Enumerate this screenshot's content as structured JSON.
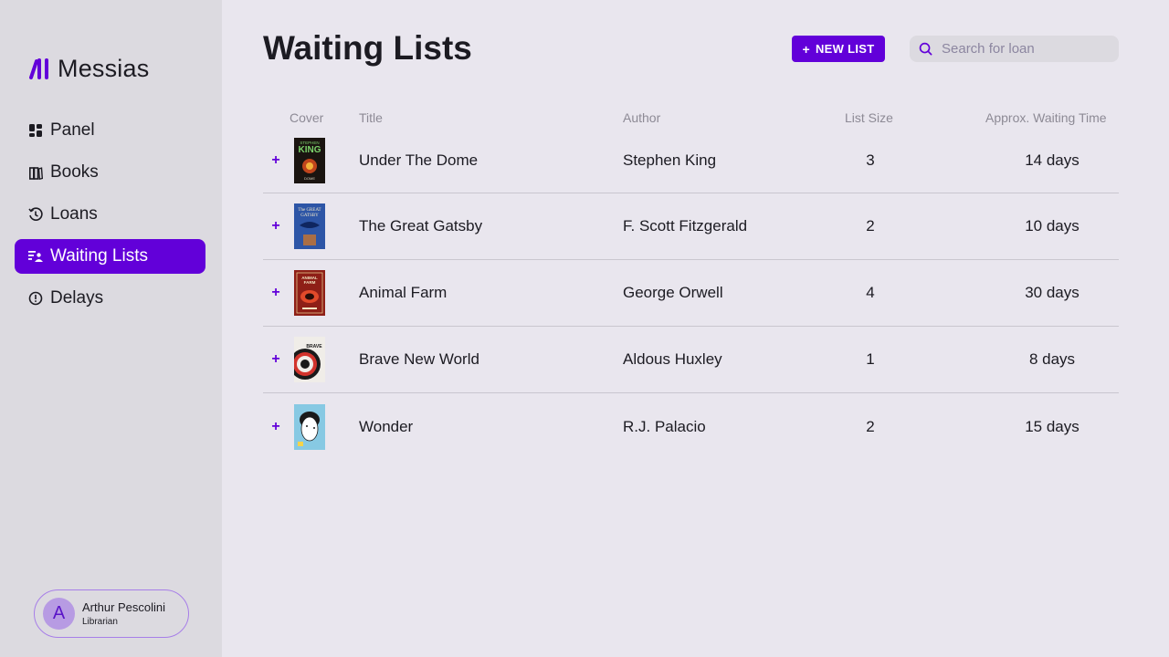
{
  "brand": {
    "name": "Messias",
    "accent": "#6200d9"
  },
  "sidebar": {
    "items": [
      {
        "label": "Panel",
        "icon": "panel-icon",
        "active": false
      },
      {
        "label": "Books",
        "icon": "books-icon",
        "active": false
      },
      {
        "label": "Loans",
        "icon": "loans-icon",
        "active": false
      },
      {
        "label": "Waiting Lists",
        "icon": "waiting-list-icon",
        "active": true
      },
      {
        "label": "Delays",
        "icon": "delay-icon",
        "active": false
      }
    ]
  },
  "user": {
    "initial": "A",
    "name": "Arthur Pescolini",
    "role": "Librarian"
  },
  "header": {
    "title": "Waiting Lists",
    "new_list_label": "NEW LIST",
    "search_placeholder": "Search for loan"
  },
  "table": {
    "columns": {
      "cover": "Cover",
      "title": "Title",
      "author": "Author",
      "size": "List Size",
      "wait": "Approx. Waiting Time"
    },
    "rows": [
      {
        "title": "Under The Dome",
        "author": "Stephen King",
        "size": "3",
        "wait": "14 days",
        "cover_icon": "under-the-dome-cover"
      },
      {
        "title": "The Great Gatsby",
        "author": "F. Scott Fitzgerald",
        "size": "2",
        "wait": "10 days",
        "cover_icon": "great-gatsby-cover"
      },
      {
        "title": "Animal Farm",
        "author": "George Orwell",
        "size": "4",
        "wait": "30 days",
        "cover_icon": "animal-farm-cover"
      },
      {
        "title": "Brave New World",
        "author": "Aldous Huxley",
        "size": "1",
        "wait": "8 days",
        "cover_icon": "brave-new-world-cover"
      },
      {
        "title": "Wonder",
        "author": "R.J. Palacio",
        "size": "2",
        "wait": "15 days",
        "cover_icon": "wonder-cover"
      }
    ]
  }
}
